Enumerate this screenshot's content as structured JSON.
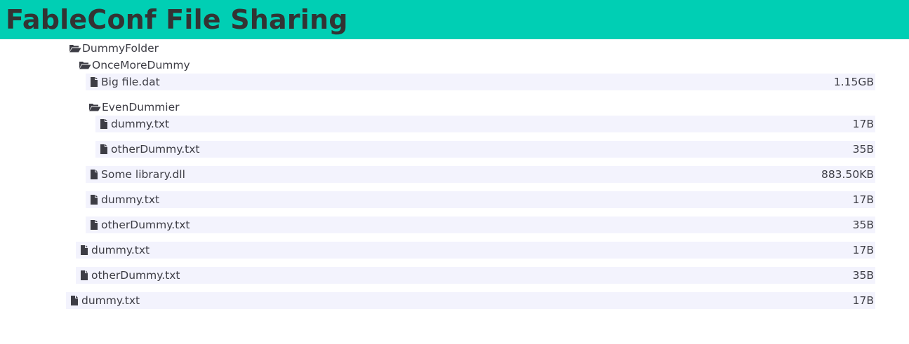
{
  "header": {
    "title": "FableConf File Sharing"
  },
  "colors": {
    "accent": "#00cfb4",
    "row_background": "#f3f3fd",
    "text": "#3d3d45"
  },
  "tree": [
    {
      "type": "folder",
      "depth": 0,
      "name": "DummyFolder",
      "icon": "folder-open-icon"
    },
    {
      "type": "folder",
      "depth": 1,
      "name": "OnceMoreDummy",
      "icon": "folder-open-icon"
    },
    {
      "type": "file",
      "depth": 2,
      "name": "Big file.dat",
      "size": "1.15GB",
      "icon": "file-icon"
    },
    {
      "type": "folder",
      "depth": 2,
      "name": "EvenDummier",
      "icon": "folder-open-icon"
    },
    {
      "type": "file",
      "depth": 3,
      "name": "dummy.txt",
      "size": "17B",
      "icon": "file-icon"
    },
    {
      "type": "file",
      "depth": 3,
      "name": "otherDummy.txt",
      "size": "35B",
      "icon": "file-icon"
    },
    {
      "type": "file",
      "depth": 2,
      "name": "Some library.dll",
      "size": "883.50KB",
      "icon": "file-icon"
    },
    {
      "type": "file",
      "depth": 2,
      "name": "dummy.txt",
      "size": "17B",
      "icon": "file-icon"
    },
    {
      "type": "file",
      "depth": 2,
      "name": "otherDummy.txt",
      "size": "35B",
      "icon": "file-icon"
    },
    {
      "type": "file",
      "depth": 1,
      "name": "dummy.txt",
      "size": "17B",
      "icon": "file-icon"
    },
    {
      "type": "file",
      "depth": 1,
      "name": "otherDummy.txt",
      "size": "35B",
      "icon": "file-icon"
    },
    {
      "type": "file",
      "depth": 0,
      "name": "dummy.txt",
      "size": "17B",
      "icon": "file-icon"
    }
  ]
}
